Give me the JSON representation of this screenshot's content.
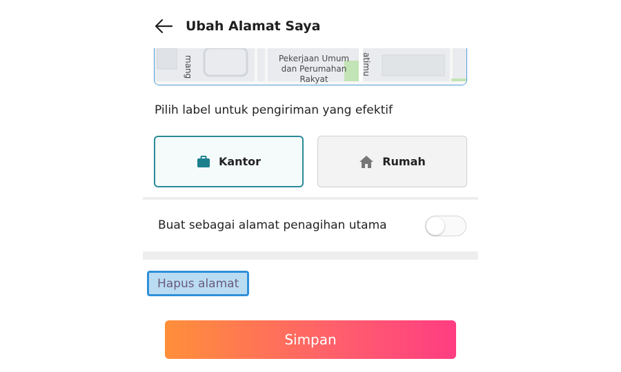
{
  "header": {
    "title": "Ubah Alamat Saya",
    "back_icon": "arrow-left-icon"
  },
  "map": {
    "place_label_line1": "Pekerjaan Umum",
    "place_label_line2": "dan Perumahan",
    "place_label_line3": "Rakyat",
    "street_left": "mang",
    "street_right": "atimu"
  },
  "address_label": {
    "prompt": "Pilih label untuk pengiriman yang efektif",
    "options": [
      {
        "label": "Kantor",
        "icon": "briefcase-icon",
        "selected": true
      },
      {
        "label": "Rumah",
        "icon": "home-icon",
        "selected": false
      }
    ]
  },
  "billing": {
    "label": "Buat sebagai alamat penagihan utama",
    "enabled": false
  },
  "delete": {
    "label": "Hapus alamat"
  },
  "save": {
    "label": "Simpan"
  },
  "colors": {
    "accent_teal": "#2a8a97",
    "save_gradient_start": "#ff8f3a",
    "save_gradient_end": "#ff3d82",
    "focus_blue": "#2f8fd8"
  }
}
